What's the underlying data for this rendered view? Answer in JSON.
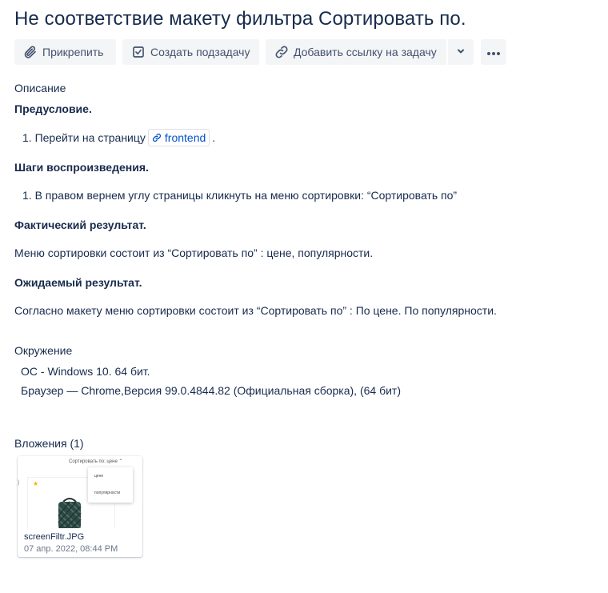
{
  "issue": {
    "title": "Не соответствие макету фильтра Сортировать по."
  },
  "toolbar": {
    "attach_label": "Прикрепить",
    "subtask_label": "Создать подзадачу",
    "link_label": "Добавить ссылку на задачу"
  },
  "description": {
    "label": "Описание",
    "precondition_heading": "Предусловие.",
    "precondition_step_text": "1. Перейти на страницу",
    "precondition_link": "frontend",
    "precondition_tail": ".",
    "steps_heading": "Шаги воспроизведения.",
    "step_1": "1. В правом вернем углу страницы кликнуть на меню сортировки: “Сортировать по”",
    "actual_heading": "Фактический результат.",
    "actual_text": "Меню сортировки состоит из “Сортировать по” : цене, популярности.",
    "expected_heading": "Ожидаемый результат.",
    "expected_text": "Согласно макету меню сортировки состоит из “Сортировать по” : По цене.  По популярности."
  },
  "environment": {
    "label": "Окружение",
    "os": "ОС - Windows 10. 64 бит.",
    "browser": "Браузер — Chrome,Версия 99.0.4844.82 (Официальная сборка), (64 бит)"
  },
  "attachments": {
    "label": "Вложения (1)",
    "items": [
      {
        "file_name": "screenFiltr.JPG",
        "date": "07 апр. 2022, 08:44 PM",
        "thumb_sort_text": "Сортировать по: цене ⌃",
        "thumb_option_1": "цене",
        "thumb_option_2": "популярности"
      }
    ]
  },
  "colors": {
    "text": "#172b4d",
    "button_bg": "#f4f5f7",
    "button_text": "#42526e",
    "link": "#0052cc",
    "muted": "#6b778c"
  },
  "icons": {
    "attach": "paperclip-icon",
    "subtask": "subtask-checkbox-icon",
    "link": "link-icon",
    "dropdown": "chevron-down-icon",
    "more": "more-horizontal-icon"
  }
}
